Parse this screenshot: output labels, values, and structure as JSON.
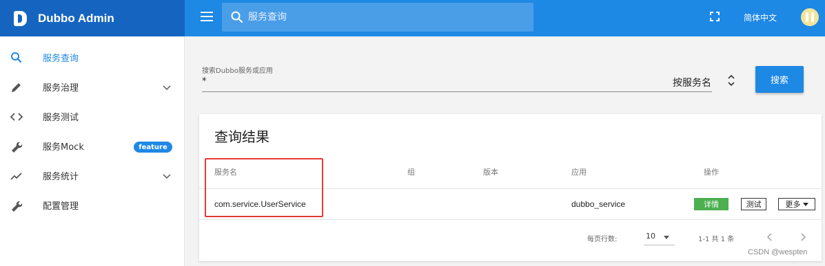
{
  "app": {
    "title": "Dubbo Admin"
  },
  "header": {
    "search_placeholder": "服务查询",
    "language": "简体中文"
  },
  "sidebar": {
    "items": [
      {
        "label": "服务查询",
        "icon": "search-icon",
        "active": true
      },
      {
        "label": "服务治理",
        "icon": "pencil-icon",
        "expandable": true
      },
      {
        "label": "服务测试",
        "icon": "code-icon"
      },
      {
        "label": "服务Mock",
        "icon": "wrench-icon",
        "badge": "feature"
      },
      {
        "label": "服务统计",
        "icon": "trending-icon",
        "expandable": true
      },
      {
        "label": "配置管理",
        "icon": "wrench-icon"
      }
    ]
  },
  "search": {
    "label": "搜索Dubbo服务或应用",
    "value": "*",
    "type_selected": "按服务名",
    "button": "搜索"
  },
  "results": {
    "title": "查询结果",
    "columns": [
      "服务名",
      "组",
      "版本",
      "应用",
      "操作"
    ],
    "rows": [
      {
        "service": "com.service.UserService",
        "group": "",
        "version": "",
        "application": "dubbo_service",
        "actions": {
          "detail": "详情",
          "test": "测试",
          "more": "更多"
        }
      }
    ],
    "pagination": {
      "rows_per_page_label": "每页行数:",
      "rows_per_page": "10",
      "range": "1-1 共 1 条"
    }
  },
  "colors": {
    "primary": "#1e88e5",
    "brand": "#1565c0",
    "success": "#4caf50",
    "highlight": "#e53935"
  },
  "watermark": "CSDN @wespten"
}
